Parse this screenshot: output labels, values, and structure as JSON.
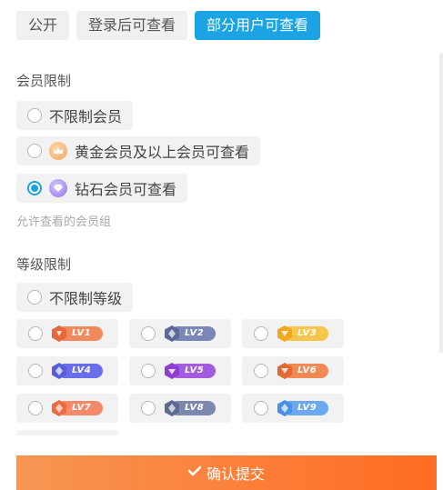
{
  "visibility_tabs": [
    {
      "label": "公开",
      "active": false
    },
    {
      "label": "登录后可查看",
      "active": false
    },
    {
      "label": "部分用户可查看",
      "active": true
    }
  ],
  "member_limit": {
    "title": "会员限制",
    "options": [
      {
        "label": "不限制会员",
        "icon": "none",
        "checked": false
      },
      {
        "label": "黄金会员及以上会员可查看",
        "icon": "crown-icon",
        "checked": false
      },
      {
        "label": "钻石会员可查看",
        "icon": "diamond-icon",
        "checked": true
      }
    ],
    "hint": "允许查看的会员组"
  },
  "level_limit": {
    "title": "等级限制",
    "unlimited_label": "不限制等级",
    "levels": [
      {
        "label": "LV1",
        "color": "#f08a5d"
      },
      {
        "label": "LV2",
        "color": "#7b86b8"
      },
      {
        "label": "LV3",
        "color": "#f7c64a"
      },
      {
        "label": "LV4",
        "color": "#6a6ee8"
      },
      {
        "label": "LV5",
        "color": "#a35ce0"
      },
      {
        "label": "LV6",
        "color": "#ef8a55"
      },
      {
        "label": "LV7",
        "color": "#f58a6a"
      },
      {
        "label": "LV8",
        "color": "#7c88ad"
      },
      {
        "label": "LV9",
        "color": "#6ca8f0"
      }
    ]
  },
  "submit": {
    "label": "确认提交",
    "icon": "check-icon"
  }
}
